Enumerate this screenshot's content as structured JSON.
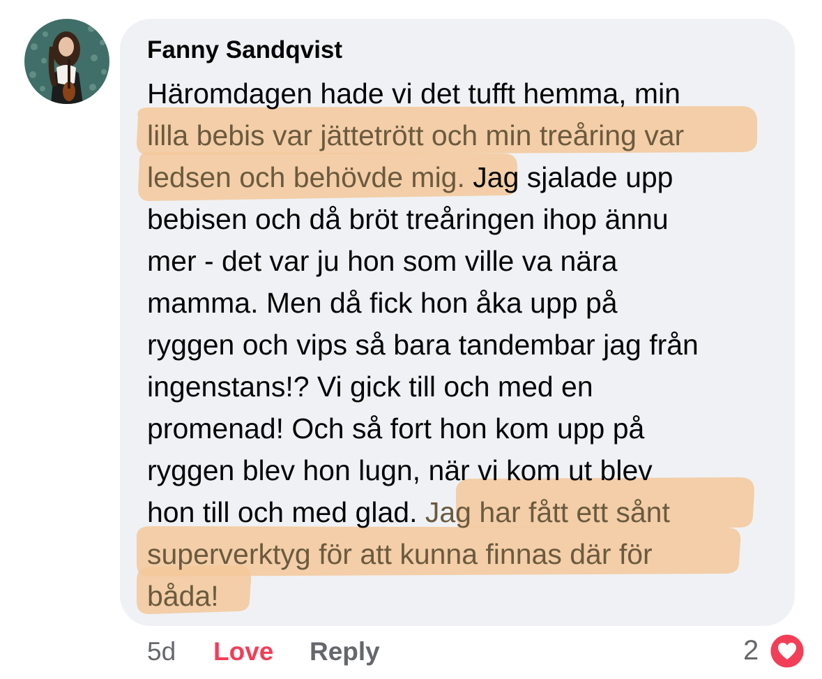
{
  "comment": {
    "author": "Fanny Sandqvist",
    "lines": [
      [
        {
          "t": "Häromdagen hade vi det tufft hemma, min",
          "m": false
        }
      ],
      [
        {
          "t": "lilla bebis var jättetrött och min treåring var",
          "m": true
        }
      ],
      [
        {
          "t": "ledsen och behövde mig.",
          "m": true
        },
        {
          "t": " Jag sjalade upp",
          "m": false
        }
      ],
      [
        {
          "t": "bebisen och då bröt treåringen ihop ännu",
          "m": false
        }
      ],
      [
        {
          "t": "mer - det var ju hon som ville va nära",
          "m": false
        }
      ],
      [
        {
          "t": "mamma. Men då fick hon åka upp på",
          "m": false
        }
      ],
      [
        {
          "t": "ryggen och vips så bara tandembar jag från",
          "m": false
        }
      ],
      [
        {
          "t": "ingenstans!? Vi gick till och med en",
          "m": false
        }
      ],
      [
        {
          "t": "promenad! Och så fort hon kom upp på",
          "m": false
        }
      ],
      [
        {
          "t": "ryggen blev hon lugn, när vi kom ut blev",
          "m": false
        }
      ],
      [
        {
          "t": "hon till och med glad. ",
          "m": false
        },
        {
          "t": "Jag har fått ett sånt",
          "m": true
        }
      ],
      [
        {
          "t": "superverktyg för att kunna finnas där för",
          "m": true
        }
      ],
      [
        {
          "t": "båda!",
          "m": true
        }
      ]
    ]
  },
  "footer": {
    "time": "5d",
    "love_label": "Love",
    "reply_label": "Reply",
    "reaction_count": "2",
    "reaction_icon": "heart-icon"
  },
  "colors": {
    "bubble": "#f0f1f4",
    "highlight": "#f3c89a",
    "love": "#f33e58"
  }
}
